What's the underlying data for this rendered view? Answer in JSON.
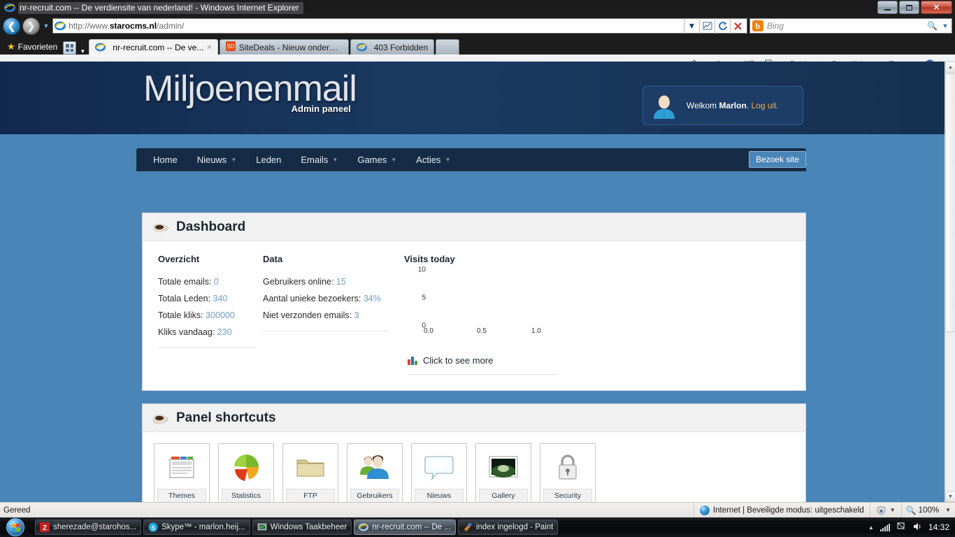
{
  "window": {
    "title": "nr-recruit.com -- De verdiensite van nederland! - Windows Internet Explorer",
    "minimize_label": "Minimaliseren",
    "maximize_label": "Maximaliseren",
    "close_label": "Sluiten"
  },
  "address_bar": {
    "url_prefix": "http://www.",
    "url_domain": "starocms.nl",
    "url_suffix": "/admin/",
    "url_full": "http://www.starocms.nl/admin/",
    "back_label": "Vorige",
    "forward_label": "Volgende",
    "refresh_label": "Vernieuwen",
    "stop_label": "Stoppen",
    "compat_label": "Compatibiliteitsweergave"
  },
  "search": {
    "provider": "Bing",
    "placeholder": "Bing",
    "value": ""
  },
  "favorites": {
    "label": "Favorieten"
  },
  "tabs": [
    {
      "label": "nr-recruit.com -- De ve...",
      "icon": "ie-icon",
      "active": true,
      "close": "×"
    },
    {
      "label": "SiteDeals - Nieuw onderwe...",
      "icon": "sitedeals-icon",
      "active": false
    },
    {
      "label": "403 Forbidden",
      "icon": "ie-icon",
      "active": false
    }
  ],
  "command_bar": {
    "items": [
      {
        "label": "",
        "icon": "home-icon",
        "caret": true
      },
      {
        "label": "",
        "icon": "feed-icon",
        "caret": true
      },
      {
        "label": "",
        "icon": "mail-icon",
        "caret": false
      },
      {
        "label": "",
        "icon": "print-icon",
        "caret": true
      },
      {
        "label": "Pagina",
        "icon": "",
        "caret": true
      },
      {
        "label": "Beveiliging",
        "icon": "",
        "caret": true
      },
      {
        "label": "Extra",
        "icon": "",
        "caret": true
      },
      {
        "label": "",
        "icon": "help-icon",
        "caret": true
      }
    ],
    "overflow": "»"
  },
  "site": {
    "brand_name": "Miljoenenmail",
    "brand_sub": "Admin paneel",
    "user_panel": {
      "welcome": "Welkom",
      "username": "Marlon",
      "separator": ".",
      "logout": "Log uit.",
      "avatar": "user-avatar-icon"
    },
    "nav": [
      {
        "label": "Home",
        "caret": false
      },
      {
        "label": "Nieuws",
        "caret": true
      },
      {
        "label": "Leden",
        "caret": false
      },
      {
        "label": "Emails",
        "caret": true
      },
      {
        "label": "Games",
        "caret": true
      },
      {
        "label": "Acties",
        "caret": true
      }
    ],
    "visit_button": "Bezoek site"
  },
  "dashboard": {
    "panel_title": "Dashboard",
    "panel_icon": "coffee-cup-icon",
    "overzicht": {
      "heading": "Overzicht",
      "rows": [
        {
          "label": "Totale emails:",
          "value": "0"
        },
        {
          "label": "Totala Leden:",
          "value": "340"
        },
        {
          "label": "Totale kliks:",
          "value": "300000"
        },
        {
          "label": "Kliks vandaag:",
          "value": "230"
        }
      ]
    },
    "data": {
      "heading": "Data",
      "rows": [
        {
          "label": "Gebruikers online:",
          "value": "15"
        },
        {
          "label": "Aantal unieke bezoekers:",
          "value": "34%"
        },
        {
          "label": "Niet verzonden emails:",
          "value": "3"
        }
      ]
    },
    "see_more": {
      "label": "Click to see more",
      "icon": "bar-chart-icon"
    }
  },
  "chart_data": {
    "type": "line",
    "title": "Visits today",
    "xlabel": "",
    "ylabel": "",
    "x": [],
    "values": [],
    "series": [],
    "xticks": [
      "0.0",
      "0.5",
      "1.0"
    ],
    "yticks": [
      "0",
      "5",
      "10"
    ],
    "xlim": [
      0.0,
      1.0
    ],
    "ylim": [
      0,
      10
    ],
    "grid": false,
    "legend": false,
    "note": "Empty plot — no data series rendered, axes only"
  },
  "shortcuts": {
    "panel_title": "Panel shortcuts",
    "panel_icon": "coffee-cup-icon",
    "items": [
      {
        "label": "Themes",
        "icon": "themes-icon"
      },
      {
        "label": "Statistics",
        "icon": "pie-chart-icon"
      },
      {
        "label": "FTP",
        "icon": "folder-icon"
      },
      {
        "label": "Gebruikers",
        "icon": "users-icon"
      },
      {
        "label": "Nieuws",
        "icon": "speech-bubble-icon"
      },
      {
        "label": "Gallery",
        "icon": "picture-icon"
      },
      {
        "label": "Security",
        "icon": "padlock-icon"
      }
    ]
  },
  "status_bar": {
    "left": "Gereed",
    "zone": "Internet | Beveiligde modus: uitgeschakeld",
    "zone_icon": "globe-icon",
    "protected_icon": "shield-icon",
    "zoom": "100%",
    "zoom_icon": "magnifier-icon"
  },
  "taskbar": {
    "start_label": "Start",
    "items": [
      {
        "label": "sherezade@starohos...",
        "icon": "filezilla-icon",
        "active": false
      },
      {
        "label": "Skype™ - marlon.heij...",
        "icon": "skype-icon",
        "active": false
      },
      {
        "label": "Windows Taakbeheer",
        "icon": "taskmgr-icon",
        "active": false
      },
      {
        "label": "nr-recruit.com -- De ...",
        "icon": "ie-icon",
        "active": true
      },
      {
        "label": "index ingelogd - Paint",
        "icon": "paint-icon",
        "active": false
      }
    ],
    "tray": {
      "show_hidden": "▲",
      "network_icon": "signal-icon",
      "action_icon": "flag-icon",
      "volume_icon": "speaker-icon",
      "clock": "14:32"
    }
  },
  "colors": {
    "site_header": "#16304f",
    "site_band": "#4a85b8",
    "navbar": "#162c46",
    "accent_value": "#6f9ec6",
    "logout_link": "#e8b34a",
    "visit_button_border": "#86b3d6"
  }
}
